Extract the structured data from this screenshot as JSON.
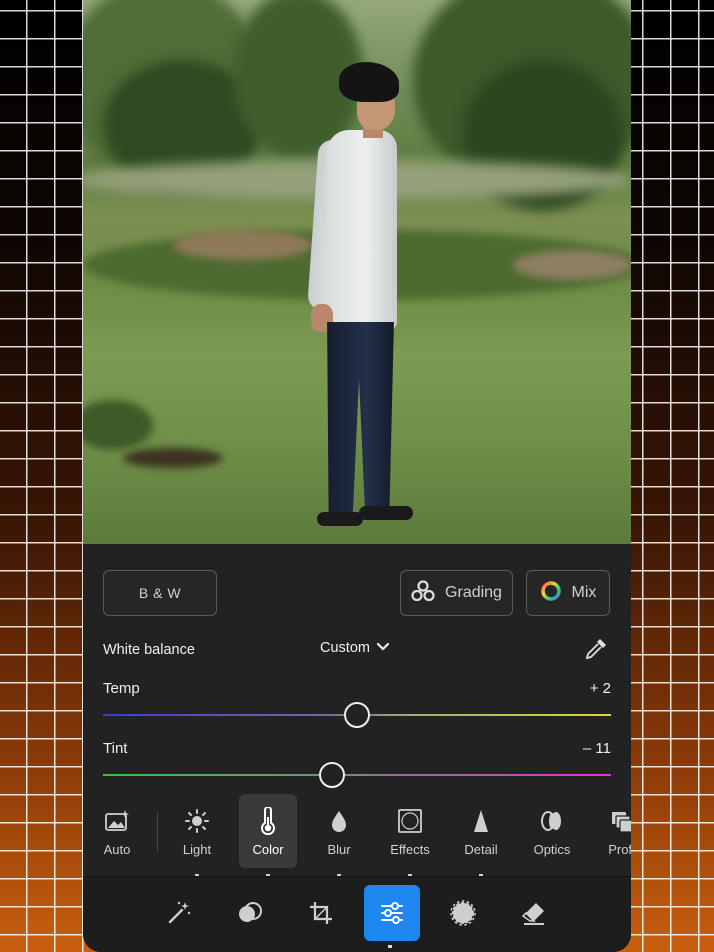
{
  "presets": {
    "bw_label": "B & W",
    "grading_label": "Grading",
    "mix_label": "Mix"
  },
  "white_balance": {
    "label": "White balance",
    "value": "Custom"
  },
  "temp": {
    "label": "Temp",
    "value": "+ 2",
    "slider_position": 0.5
  },
  "tint": {
    "label": "Tint",
    "value": "– 11",
    "slider_position": 0.45
  },
  "tools": [
    {
      "label": "Auto",
      "icon": "auto-photo-icon"
    },
    {
      "label": "Light",
      "icon": "sun-icon"
    },
    {
      "label": "Color",
      "icon": "thermometer-icon",
      "active": true
    },
    {
      "label": "Blur",
      "icon": "droplet-icon"
    },
    {
      "label": "Effects",
      "icon": "vignette-icon"
    },
    {
      "label": "Detail",
      "icon": "triangle-icon"
    },
    {
      "label": "Optics",
      "icon": "lens-icon"
    },
    {
      "label": "Profil",
      "icon": "profiles-icon"
    }
  ],
  "bottom_bar": [
    {
      "icon": "magic-wand-icon"
    },
    {
      "icon": "remix-icon"
    },
    {
      "icon": "crop-icon"
    },
    {
      "icon": "sliders-icon",
      "active": true
    },
    {
      "icon": "masking-icon"
    },
    {
      "icon": "eraser-icon"
    }
  ],
  "colors": {
    "accent": "#1e88f0",
    "panel": "#222222"
  }
}
